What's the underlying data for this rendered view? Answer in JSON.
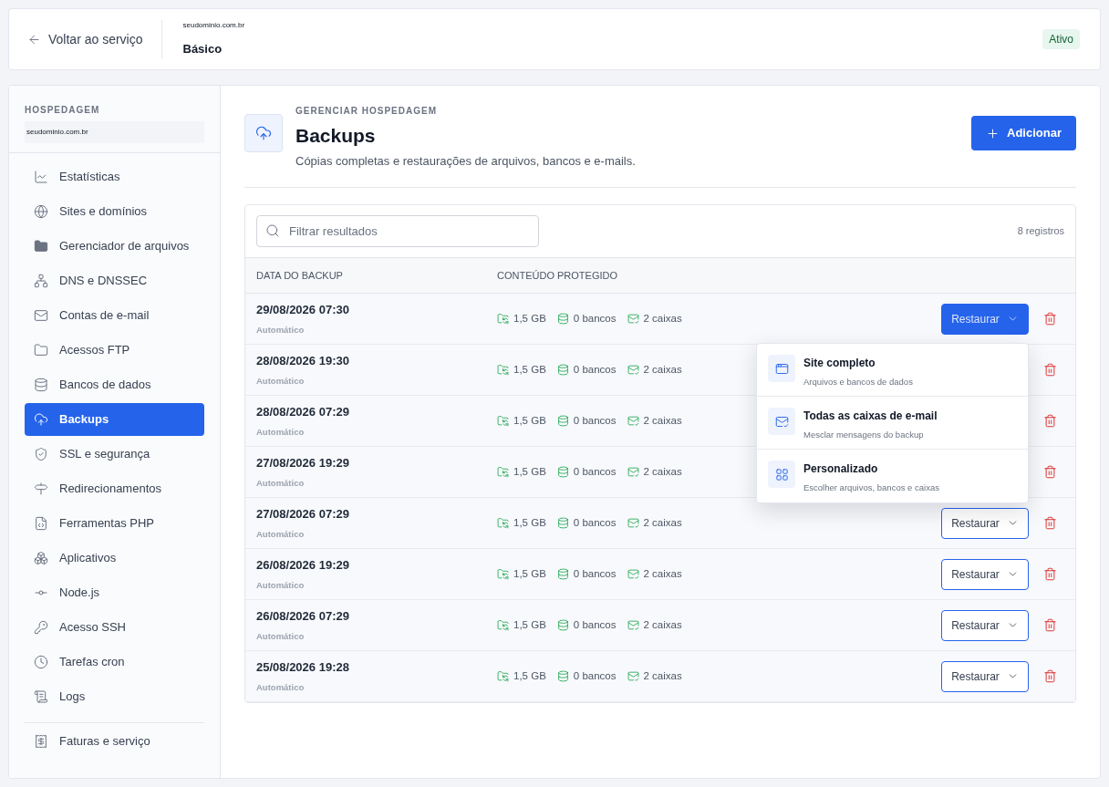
{
  "header": {
    "back_link": "Voltar ao serviço",
    "domain": "seudominio.com.br",
    "plan": "Básico",
    "status": "Ativo"
  },
  "sidebar": {
    "section": "HOSPEDAGEM",
    "domain": "seudominio.com.br",
    "items": [
      {
        "label": "Estatísticas",
        "selected": false
      },
      {
        "label": "Sites e domínios",
        "selected": false
      },
      {
        "label": "Gerenciador de arquivos",
        "selected": false
      },
      {
        "label": "DNS e DNSSEC",
        "selected": false
      },
      {
        "label": "Contas de e-mail",
        "selected": false
      },
      {
        "label": "Acessos FTP",
        "selected": false
      },
      {
        "label": "Bancos de dados",
        "selected": false
      },
      {
        "label": "Backups",
        "selected": true
      },
      {
        "label": "SSL e segurança",
        "selected": false
      },
      {
        "label": "Redirecionamentos",
        "selected": false
      },
      {
        "label": "Ferramentas PHP",
        "selected": false
      },
      {
        "label": "Aplicativos",
        "selected": false
      },
      {
        "label": "Node.js",
        "selected": false
      },
      {
        "label": "Acesso SSH",
        "selected": false
      },
      {
        "label": "Tarefas cron",
        "selected": false
      },
      {
        "label": "Logs",
        "selected": false
      }
    ],
    "footer_item": {
      "label": "Faturas e serviço",
      "selected": false
    }
  },
  "page": {
    "eyebrow": "GERENCIAR HOSPEDAGEM",
    "title": "Backups",
    "subtitle": "Cópias completas e restaurações de arquivos, bancos e e-mails.",
    "add_button": "Adicionar"
  },
  "table": {
    "search": {
      "placeholder": "Filtrar resultados"
    },
    "count": "8 registros",
    "columns": [
      "DATA DO BACKUP",
      "CONTEÚDO PROTEGIDO"
    ],
    "rows": [
      {
        "date": "29/08/2026 07:30",
        "type": "Automático",
        "size": "1,5 GB",
        "databases": "0 bancos",
        "mailboxes": "2 caixas",
        "restore": {
          "label": "Restaurar",
          "open": true
        }
      },
      {
        "date": "28/08/2026 19:30",
        "type": "Automático",
        "size": "1,5 GB",
        "databases": "0 bancos",
        "mailboxes": "2 caixas"
      },
      {
        "date": "28/08/2026 07:29",
        "type": "Automático",
        "size": "1,5 GB",
        "databases": "0 bancos",
        "mailboxes": "2 caixas"
      },
      {
        "date": "27/08/2026 19:29",
        "type": "Automático",
        "size": "1,5 GB",
        "databases": "0 bancos",
        "mailboxes": "2 caixas"
      },
      {
        "date": "27/08/2026 07:29",
        "type": "Automático",
        "size": "1,5 GB",
        "databases": "0 bancos",
        "mailboxes": "2 caixas",
        "restore": {
          "label": "Restaurar",
          "open": false
        }
      },
      {
        "date": "26/08/2026 19:29",
        "type": "Automático",
        "size": "1,5 GB",
        "databases": "0 bancos",
        "mailboxes": "2 caixas",
        "restore": {
          "label": "Restaurar",
          "open": false
        }
      },
      {
        "date": "26/08/2026 07:29",
        "type": "Automático",
        "size": "1,5 GB",
        "databases": "0 bancos",
        "mailboxes": "2 caixas",
        "restore": {
          "label": "Restaurar",
          "open": false
        }
      },
      {
        "date": "25/08/2026 19:28",
        "type": "Automático",
        "size": "1,5 GB",
        "databases": "0 bancos",
        "mailboxes": "2 caixas",
        "restore": {
          "label": "Restaurar",
          "open": false
        }
      }
    ]
  },
  "restore_menu": {
    "items": [
      {
        "title": "Site completo",
        "description": "Arquivos e bancos de dados"
      },
      {
        "title": "Todas as caixas de e-mail",
        "description": "Mesclar mensagens do backup"
      },
      {
        "title": "Personalizado",
        "description": "Escolher arquivos, bancos e caixas"
      }
    ]
  }
}
